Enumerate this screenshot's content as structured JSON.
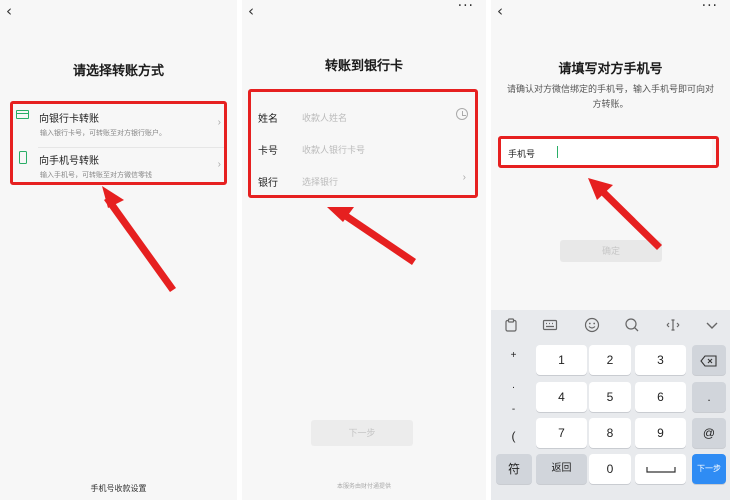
{
  "panel1": {
    "back_icon": "chevron-left",
    "title": "请选择转账方式",
    "options": [
      {
        "icon": "bank-card-icon",
        "title": "向银行卡转账",
        "subtitle": "输入银行卡号，可转账至对方银行账户。"
      },
      {
        "icon": "mobile-phone-icon",
        "title": "向手机号转账",
        "subtitle": "输入手机号，可转账至对方微信零钱"
      }
    ],
    "footer_link": "手机号收款设置"
  },
  "panel2": {
    "back_icon": "chevron-left",
    "more_icon": "more-dots",
    "title": "转账到银行卡",
    "fields": [
      {
        "label": "姓名",
        "placeholder": "收款人姓名",
        "icon": "clock-icon"
      },
      {
        "label": "卡号",
        "placeholder": "收款人银行卡号",
        "icon": ""
      },
      {
        "label": "银行",
        "placeholder": "选择银行",
        "icon": "chevron-right-icon"
      }
    ],
    "next_button": "下一步",
    "service_note": "本服务由财付通提供"
  },
  "panel3": {
    "back_icon": "chevron-left",
    "more_icon": "more-dots",
    "title": "请填写对方手机号",
    "description": "请确认对方微信绑定的手机号，输入手机号即可向对方转账。",
    "phone_label": "手机号",
    "phone_value": "",
    "confirm_button": "确定",
    "keyboard": {
      "toolbar_icons": [
        "clipboard-icon",
        "keyboard-icon",
        "emoji-icon",
        "search-icon",
        "cursor-move-icon",
        "collapse-icon"
      ],
      "symbols": [
        "+",
        ".",
        "-",
        "("
      ],
      "rows": [
        [
          "1",
          "2",
          "3",
          "⌫"
        ],
        [
          "4",
          "5",
          "6",
          "."
        ],
        [
          "7",
          "8",
          "9",
          "@"
        ],
        [
          "符",
          "返回",
          "0",
          "␣",
          "下一步"
        ]
      ]
    }
  },
  "annotation_color": "#e62020",
  "accent_color": "#2aae67"
}
